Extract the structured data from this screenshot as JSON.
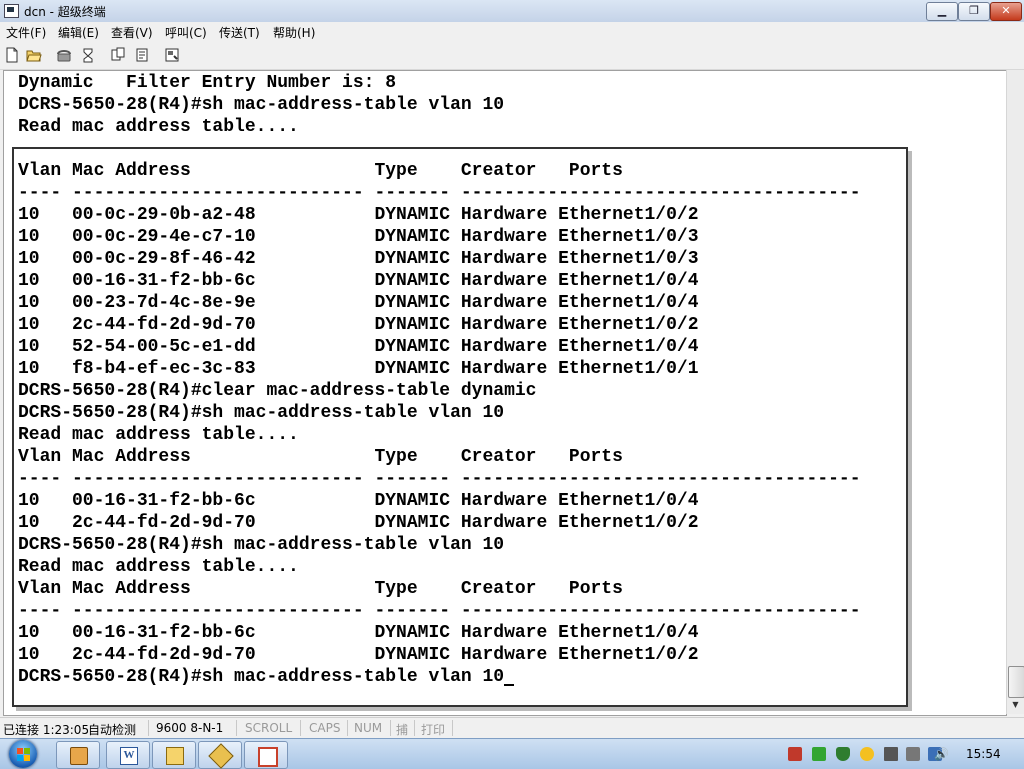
{
  "window": {
    "title": "dcn - 超级终端"
  },
  "titlebar_buttons": {
    "minimize": "▁",
    "maximize": "❐",
    "close": "✕"
  },
  "menu": [
    {
      "label": "文件(F)"
    },
    {
      "label": "编辑(E)"
    },
    {
      "label": "查看(V)"
    },
    {
      "label": "呼叫(C)"
    },
    {
      "label": "传送(T)"
    },
    {
      "label": "帮助(H)"
    }
  ],
  "toolbar": {
    "icons": [
      "new-file-icon",
      "open-folder-icon",
      "phone-connect-icon",
      "phone-disconnect-icon",
      "send-file-icon",
      "receive-file-icon",
      "properties-icon"
    ]
  },
  "terminal": {
    "lines": [
      "Dynamic   Filter Entry Number is: 8",
      "DCRS-5650-28(R4)#sh mac-address-table vlan 10",
      "Read mac address table....",
      "",
      "Vlan Mac Address                 Type    Creator   Ports",
      "---- --------------------------- ------- -------------------------------------",
      "10   00-0c-29-0b-a2-48           DYNAMIC Hardware Ethernet1/0/2",
      "10   00-0c-29-4e-c7-10           DYNAMIC Hardware Ethernet1/0/3",
      "10   00-0c-29-8f-46-42           DYNAMIC Hardware Ethernet1/0/3",
      "10   00-16-31-f2-bb-6c           DYNAMIC Hardware Ethernet1/0/4",
      "10   00-23-7d-4c-8e-9e           DYNAMIC Hardware Ethernet1/0/4",
      "10   2c-44-fd-2d-9d-70           DYNAMIC Hardware Ethernet1/0/2",
      "10   52-54-00-5c-e1-dd           DYNAMIC Hardware Ethernet1/0/4",
      "10   f8-b4-ef-ec-3c-83           DYNAMIC Hardware Ethernet1/0/1",
      "DCRS-5650-28(R4)#clear mac-address-table dynamic",
      "DCRS-5650-28(R4)#sh mac-address-table vlan 10",
      "Read mac address table....",
      "Vlan Mac Address                 Type    Creator   Ports",
      "---- --------------------------- ------- -------------------------------------",
      "10   00-16-31-f2-bb-6c           DYNAMIC Hardware Ethernet1/0/4",
      "10   2c-44-fd-2d-9d-70           DYNAMIC Hardware Ethernet1/0/2",
      "DCRS-5650-28(R4)#sh mac-address-table vlan 10",
      "Read mac address table....",
      "Vlan Mac Address                 Type    Creator   Ports",
      "---- --------------------------- ------- -------------------------------------",
      "10   00-16-31-f2-bb-6c           DYNAMIC Hardware Ethernet1/0/4",
      "10   2c-44-fd-2d-9d-70           DYNAMIC Hardware Ethernet1/0/2"
    ],
    "prompt_line": "DCRS-5650-28(R4)#sh mac-address-table vlan 10"
  },
  "status": {
    "connected": "已连接 1:23:05",
    "detect": "自动检测",
    "baud": "9600 8-N-1",
    "scroll": "SCROLL",
    "caps": "CAPS",
    "num": "NUM",
    "capture": "捕",
    "print": "打印"
  },
  "taskbar": {
    "apps": [
      "explorer-icon",
      "word-icon",
      "folder-icon",
      "app-icon",
      "presentation-icon"
    ],
    "tray_icons": [
      "network-icon",
      "battery-icon",
      "shield-icon",
      "security-icon",
      "printer-icon",
      "phone-icon",
      "usb-icon",
      "volume-icon"
    ],
    "clock": "15:54"
  },
  "colors": {
    "terminal_bg": "#ffffff",
    "terminal_fg": "#000000",
    "taskbar": "#b5cde9"
  }
}
